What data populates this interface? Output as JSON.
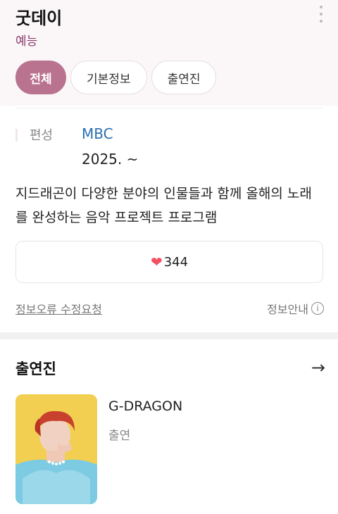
{
  "header": {
    "title": "굿데이",
    "genre": "예능",
    "more_icon": "more-vertical-icon"
  },
  "tabs": [
    {
      "label": "전체",
      "active": true
    },
    {
      "label": "기본정보",
      "active": false
    },
    {
      "label": "출연진",
      "active": false
    }
  ],
  "info": {
    "label": "편성",
    "channel": "MBC",
    "date": "2025. ~"
  },
  "description": "지드래곤이 다양한 분야의 인물들과 함께 올해의 노래를 완성하는 음악 프로젝트 프로그램",
  "like": {
    "icon": "heart-icon",
    "count": "344"
  },
  "footer_links": {
    "report": "정보오류 수정요청",
    "guide": "정보안내",
    "guide_icon": "info-icon"
  },
  "cast_section": {
    "title": "출연진",
    "arrow_icon": "arrow-right-icon",
    "members": [
      {
        "name": "G-DRAGON",
        "role": "출연"
      }
    ]
  },
  "colors": {
    "accent": "#b9738f",
    "genre": "#8a3c6c",
    "link": "#2a6fb0",
    "heart": "#f25060"
  }
}
